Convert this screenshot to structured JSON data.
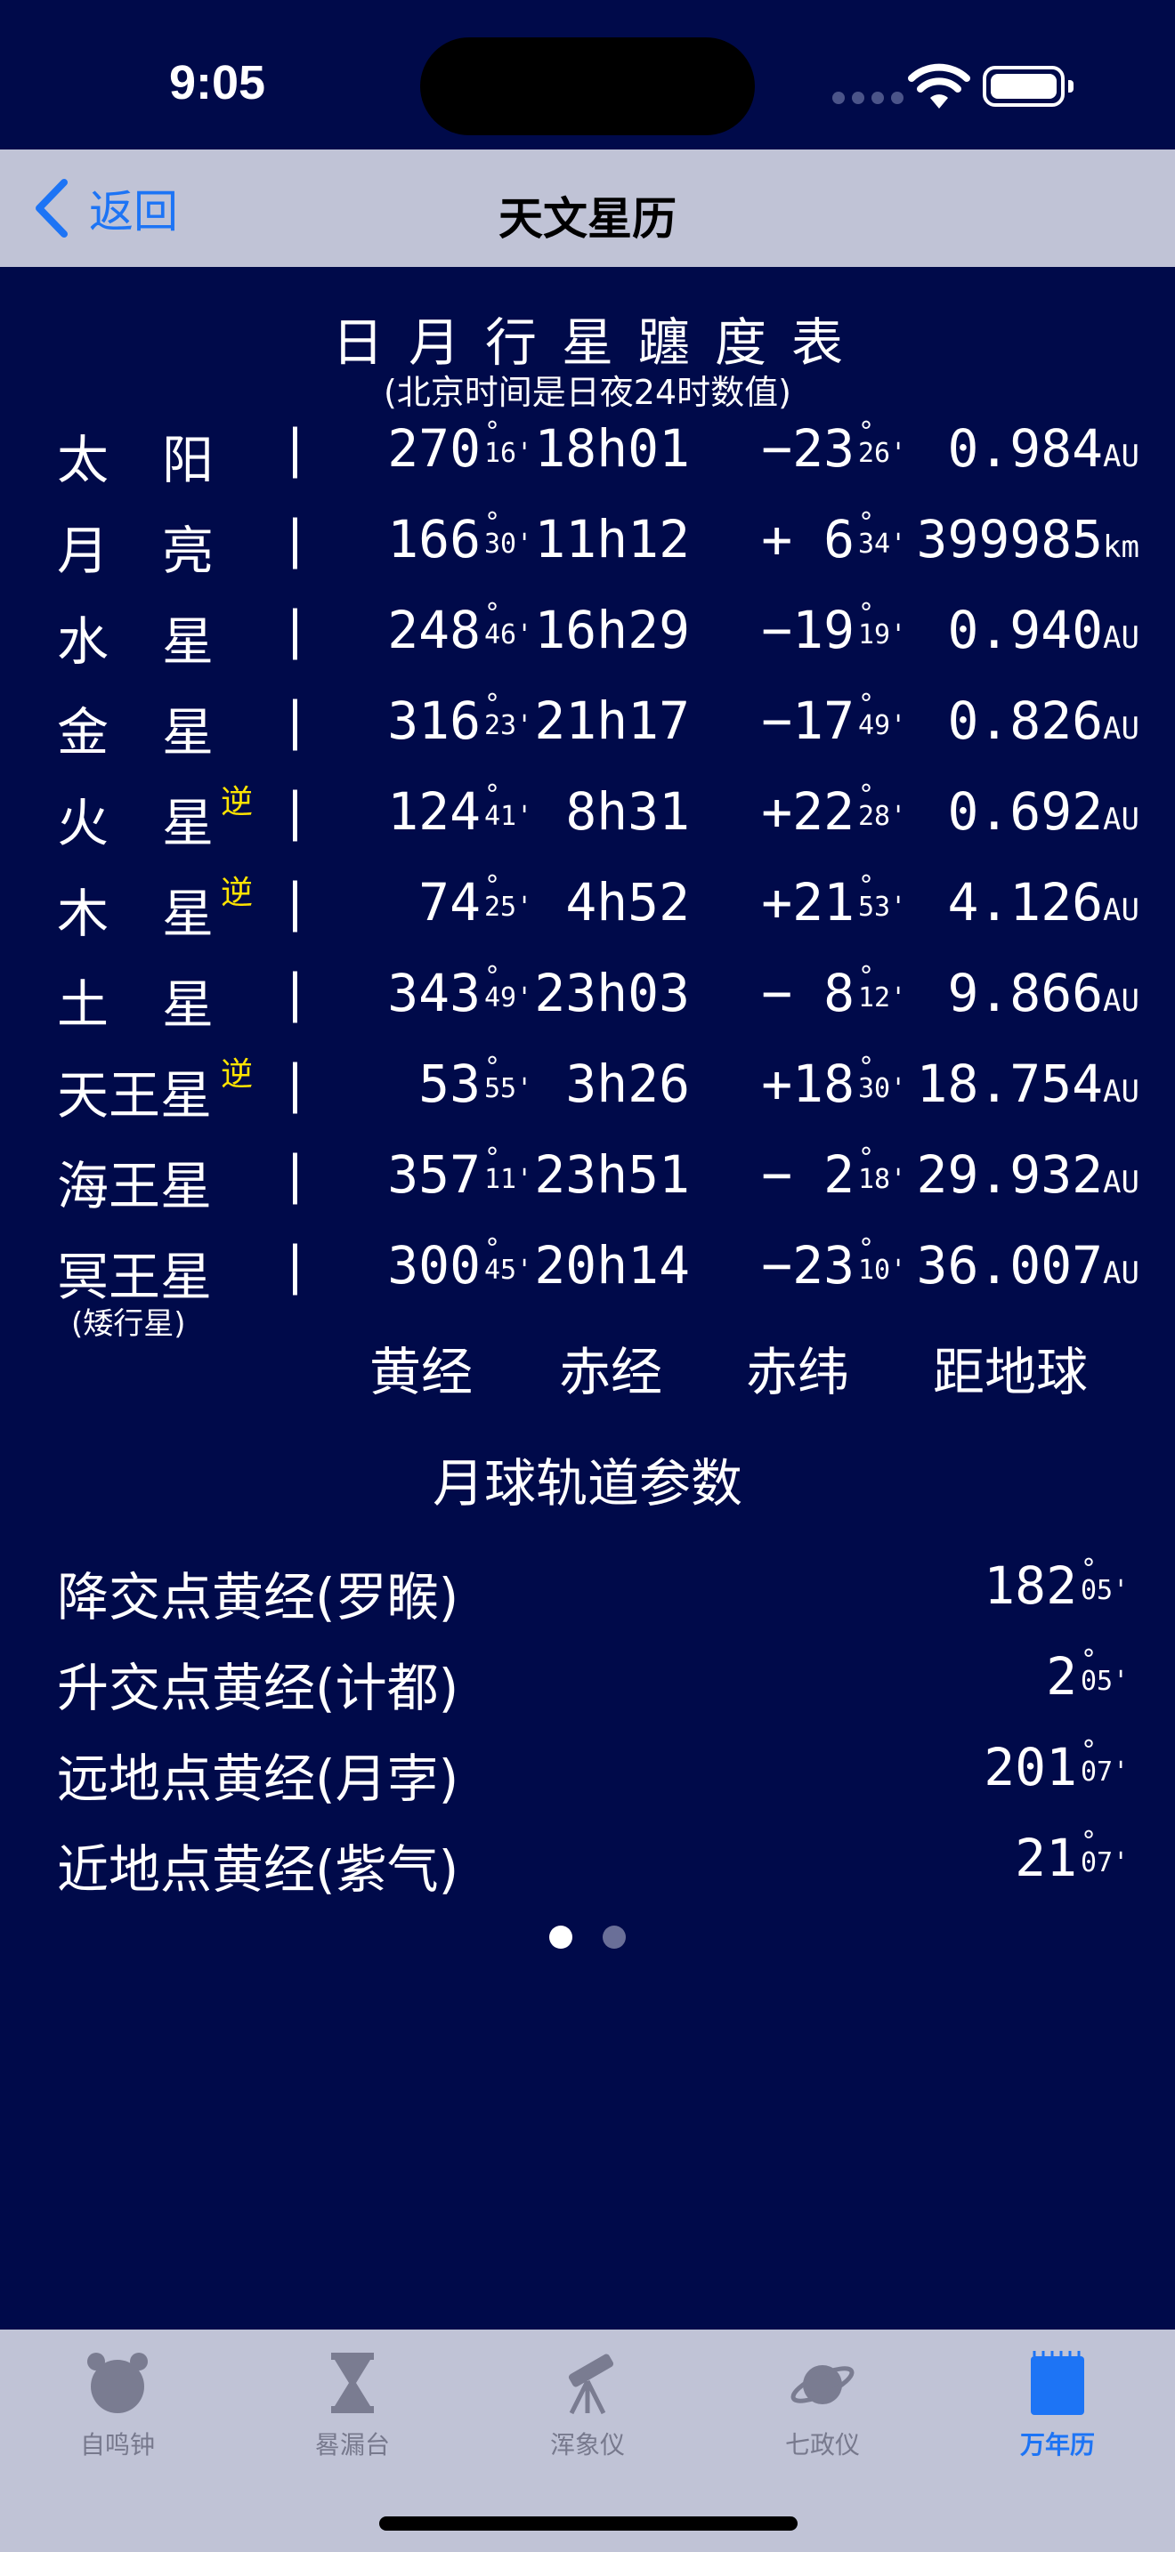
{
  "status": {
    "time": "9:05"
  },
  "nav": {
    "back_label": "返回",
    "title": "天文星历"
  },
  "table": {
    "title": "日月行星躔度表",
    "subtitle": "(北京时间是日夜24时数值)",
    "retro_mark": "逆",
    "separator": "|",
    "rows": [
      {
        "name": "太阳",
        "retro": "",
        "lon_deg": "270",
        "lon_min": "16",
        "ra": "18h01",
        "dec_deg": "−23",
        "dec_min": "26",
        "dist": "0.984",
        "unit": "AU"
      },
      {
        "name": "月亮",
        "retro": "",
        "lon_deg": "166",
        "lon_min": "30",
        "ra": "11h12",
        "dec_deg": "+ 6",
        "dec_min": "34",
        "dist": "399985",
        "unit": "km"
      },
      {
        "name": "水星",
        "retro": "",
        "lon_deg": "248",
        "lon_min": "46",
        "ra": "16h29",
        "dec_deg": "−19",
        "dec_min": "19",
        "dist": "0.940",
        "unit": "AU"
      },
      {
        "name": "金星",
        "retro": "",
        "lon_deg": "316",
        "lon_min": "23",
        "ra": "21h17",
        "dec_deg": "−17",
        "dec_min": "49",
        "dist": "0.826",
        "unit": "AU"
      },
      {
        "name": "火星",
        "retro": "逆",
        "lon_deg": "124",
        "lon_min": "41",
        "ra": "8h31",
        "dec_deg": "+22",
        "dec_min": "28",
        "dist": "0.692",
        "unit": "AU"
      },
      {
        "name": "木星",
        "retro": "逆",
        "lon_deg": "74",
        "lon_min": "25",
        "ra": "4h52",
        "dec_deg": "+21",
        "dec_min": "53",
        "dist": "4.126",
        "unit": "AU"
      },
      {
        "name": "土星",
        "retro": "",
        "lon_deg": "343",
        "lon_min": "49",
        "ra": "23h03",
        "dec_deg": "− 8",
        "dec_min": "12",
        "dist": "9.866",
        "unit": "AU"
      },
      {
        "name": "天王星",
        "retro": "逆",
        "lon_deg": "53",
        "lon_min": "55",
        "ra": "3h26",
        "dec_deg": "+18",
        "dec_min": "30",
        "dist": "18.754",
        "unit": "AU"
      },
      {
        "name": "海王星",
        "retro": "",
        "lon_deg": "357",
        "lon_min": "11",
        "ra": "23h51",
        "dec_deg": "− 2",
        "dec_min": "18",
        "dist": "29.932",
        "unit": "AU"
      },
      {
        "name": "冥王星",
        "retro": "",
        "note": "(矮行星)",
        "lon_deg": "300",
        "lon_min": "45",
        "ra": "20h14",
        "dec_deg": "−23",
        "dec_min": "10",
        "dist": "36.007",
        "unit": "AU"
      }
    ],
    "headers": {
      "lon": "黄经",
      "ra": "赤经",
      "dec": "赤纬",
      "dist": "距地球"
    }
  },
  "moon": {
    "title": "月球轨道参数",
    "rows": [
      {
        "label": "降交点黄经(罗睺)",
        "deg": "182",
        "min": "05"
      },
      {
        "label": "升交点黄经(计都)",
        "deg": "2",
        "min": "05"
      },
      {
        "label": "远地点黄经(月孛)",
        "deg": "201",
        "min": "07"
      },
      {
        "label": "近地点黄经(紫气)",
        "deg": "21",
        "min": "07"
      }
    ]
  },
  "tabs": [
    {
      "label": "自鸣钟",
      "icon": "alarm-clock-icon"
    },
    {
      "label": "晷漏台",
      "icon": "hourglass-icon"
    },
    {
      "label": "浑象仪",
      "icon": "telescope-icon"
    },
    {
      "label": "七政仪",
      "icon": "planet-icon"
    },
    {
      "label": "万年历",
      "icon": "calendar-icon",
      "active": true
    }
  ],
  "colors": {
    "background": "#000a4a",
    "bar": "#c0c3d6",
    "accent": "#1d74f5",
    "retro": "#ffe400"
  }
}
